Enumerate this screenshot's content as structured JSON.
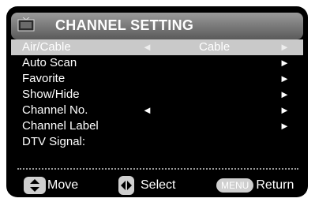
{
  "title": {
    "text": "CHANNEL SETTING",
    "icon": "tv-icon"
  },
  "menu": {
    "rows": [
      {
        "label": "Air/Cable",
        "value": "Cable",
        "left_arrow": "◄",
        "right_arrow": "►"
      },
      {
        "label": "Auto Scan",
        "value": "",
        "left_arrow": "",
        "right_arrow": "►"
      },
      {
        "label": "Favorite",
        "value": "",
        "left_arrow": "",
        "right_arrow": "►"
      },
      {
        "label": "Show/Hide",
        "value": "",
        "left_arrow": "",
        "right_arrow": "►"
      },
      {
        "label": "Channel No.",
        "value": "",
        "left_arrow": "◄",
        "right_arrow": "►"
      },
      {
        "label": "Channel Label",
        "value": "",
        "left_arrow": "",
        "right_arrow": "►"
      },
      {
        "label": "DTV Signal:",
        "value": "",
        "left_arrow": "",
        "right_arrow": ""
      }
    ]
  },
  "footer": {
    "move_label": "Move",
    "select_label": "Select",
    "menu_key": "MENU",
    "return_label": "Return"
  },
  "colors": {
    "screen_bg": "#000000",
    "selection": "#c9c9c9",
    "text": "#ffffff"
  }
}
